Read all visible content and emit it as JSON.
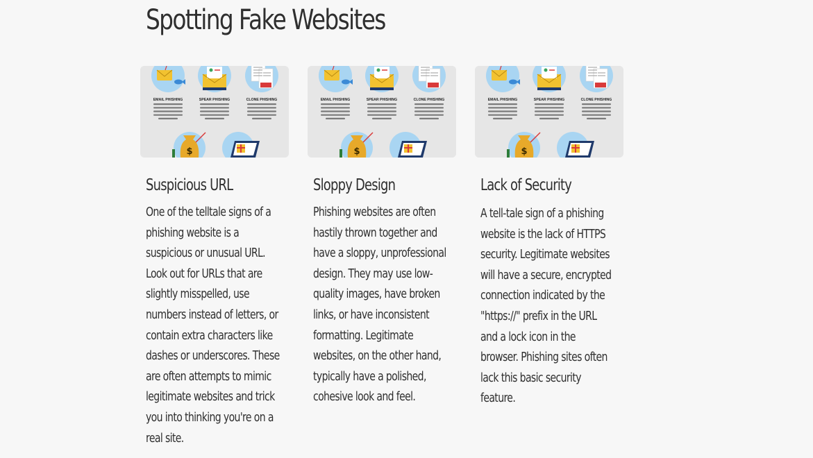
{
  "page": {
    "title": "Spotting Fake Websites"
  },
  "thumbnail": {
    "labels": [
      "EMAIL PHISHING",
      "SPEAR PHISHING",
      "CLONE PHISHING"
    ],
    "colors": {
      "circle": "#a9d5f2",
      "envelope": "#f2c230",
      "fish": "#3b8ad6",
      "bag": "#e7a92a",
      "red": "#d93a3a",
      "navy": "#1f3a6b"
    }
  },
  "cards": [
    {
      "title": "Suspicious URL",
      "text": "One of the telltale signs of a phishing website is a suspicious or unusual URL. Look out for URLs that are slightly misspelled, use numbers instead of letters, or contain extra characters like dashes or underscores. These are often attempts to mimic legitimate websites and trick you into thinking you're on a real site."
    },
    {
      "title": "Sloppy Design",
      "text": "Phishing websites are often hastily thrown together and have a sloppy, unprofessional design. They may use low-quality images, have broken links, or have inconsistent formatting. Legitimate websites, on the other hand, typically have a polished, cohesive look and feel."
    },
    {
      "title": "Lack of Security",
      "text": "A tell-tale sign of a phishing website is the lack of HTTPS security. Legitimate websites will have a secure, encrypted connection indicated by the \"https://\" prefix in the URL and a lock icon in the browser. Phishing sites often lack this basic security feature."
    }
  ]
}
